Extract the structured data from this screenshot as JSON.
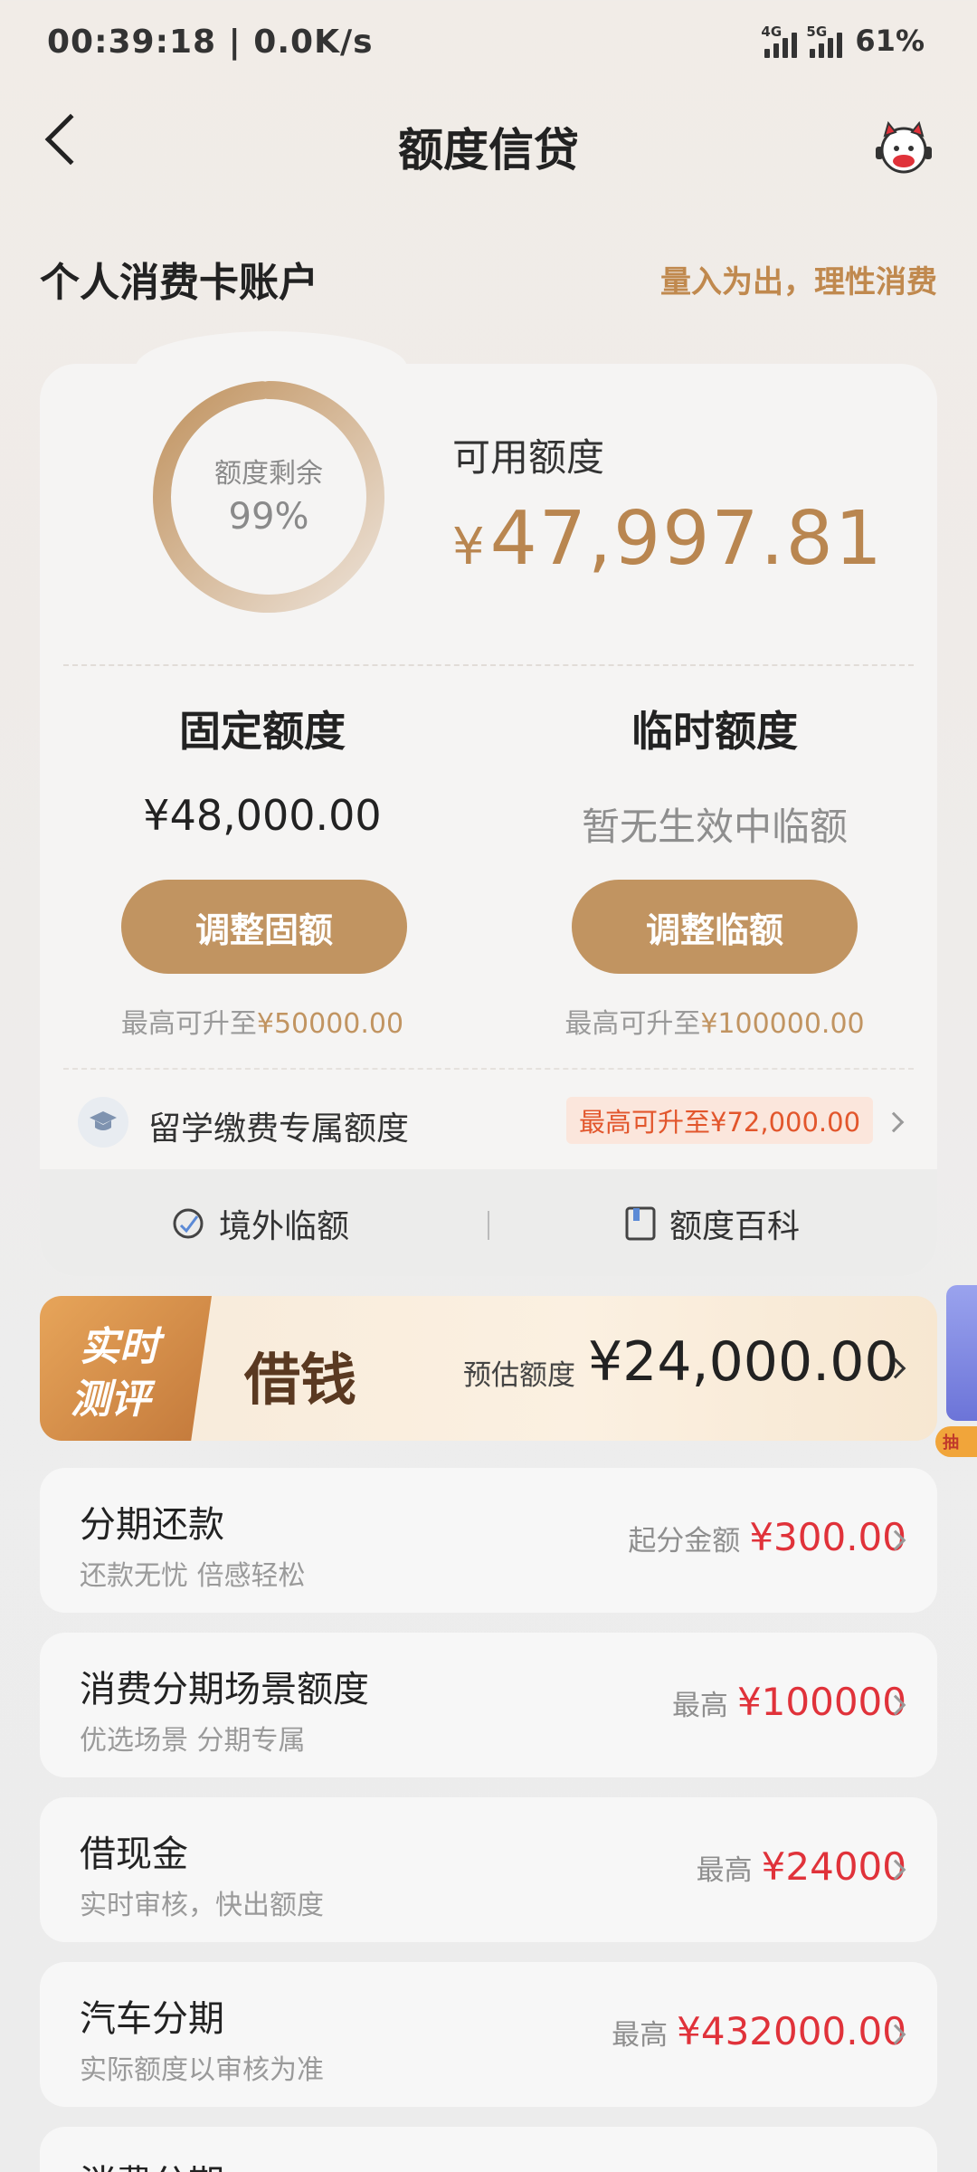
{
  "status": {
    "time": "00:39:18 | 0.0K/s",
    "net1": "4G",
    "net2": "5G",
    "battery": "61%"
  },
  "nav": {
    "title": "额度信贷"
  },
  "account": {
    "title": "个人消费卡账户",
    "slogan": "量入为出，理性消费"
  },
  "quota": {
    "ring_label": "额度剩余",
    "ring_percent_text": "99%",
    "ring_percent": 0.99,
    "available_label": "可用额度",
    "available_currency": "¥",
    "available_amount": "47,997.81"
  },
  "fixed": {
    "title": "固定额度",
    "value": "¥48,000.00",
    "button": "调整固额",
    "hint_prefix": "最高可升至",
    "hint_amount": "¥50000.00"
  },
  "temp": {
    "title": "临时额度",
    "value": "暂无生效中临额",
    "button": "调整临额",
    "hint_prefix": "最高可升至",
    "hint_amount": "¥100000.00"
  },
  "study": {
    "label": "留学缴费专属额度",
    "badge": "最高可升至¥72,000.00"
  },
  "links": {
    "overseas": "境外临额",
    "wiki": "额度百科"
  },
  "borrow": {
    "badge_line1": "实时",
    "badge_line2": "测评",
    "title": "借钱",
    "estimate_label": "预估额度",
    "estimate_amount": "¥24,000.00"
  },
  "side_ad": {
    "tag": "抽"
  },
  "items": [
    {
      "title": "分期还款",
      "subtitle": "还款无忧 倍感轻松",
      "prefix": "起分金额",
      "amount": "¥300.00"
    },
    {
      "title": "消费分期场景额度",
      "subtitle": "优选场景 分期专属",
      "prefix": "最高",
      "amount": "¥100000"
    },
    {
      "title": "借现金",
      "subtitle": "实时审核，快出额度",
      "prefix": "最高",
      "amount": "¥24000"
    },
    {
      "title": "汽车分期",
      "subtitle": "实际额度以审核为准",
      "prefix": "最高",
      "amount": "¥432000.00"
    },
    {
      "title": "消费分期"
    }
  ],
  "colors": {
    "gold": "#c19461",
    "red": "#e0323a",
    "orange_badge": "#e2562c"
  }
}
